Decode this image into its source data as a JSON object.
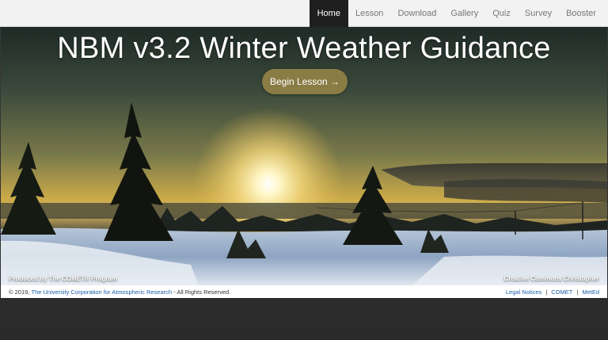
{
  "nav": {
    "items": [
      {
        "label": "Home",
        "active": true
      },
      {
        "label": "Lesson"
      },
      {
        "label": "Download"
      },
      {
        "label": "Gallery"
      },
      {
        "label": "Quiz"
      },
      {
        "label": "Survey"
      },
      {
        "label": "Booster"
      }
    ]
  },
  "hero": {
    "title": "NBM v3.2 Winter Weather Guidance",
    "begin_label": "Begin Lesson →",
    "credit_left": "Produced by The COMET® Program",
    "credit_right": "Creative Commons Christopher"
  },
  "footer": {
    "copyright_prefix": "© 2019,",
    "ucar_link": "The University Corporation for Atmospheric Research",
    "copyright_suffix": "- All Rights Reserved.",
    "links": [
      "Legal Notices",
      "COMET",
      "MetEd"
    ],
    "separator": "|"
  },
  "colors": {
    "nav_active_bg": "#1f1f1f",
    "button_bg": "#8a7c45",
    "link": "#1a5fa8"
  }
}
